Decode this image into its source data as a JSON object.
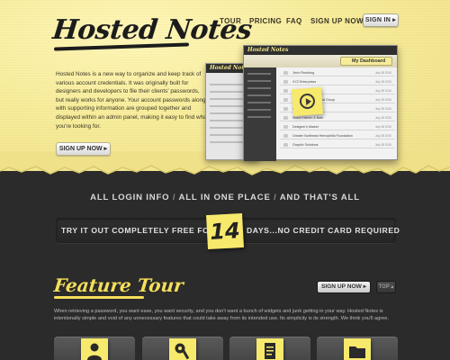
{
  "brand": {
    "logo_text": "Hosted Notes"
  },
  "nav": {
    "items": [
      {
        "label": "TOUR"
      },
      {
        "label": "PRICING"
      },
      {
        "label": "FAQ"
      },
      {
        "label": "SIGN UP NOW"
      }
    ],
    "sign_in_label": "SIGN IN ▸"
  },
  "hero": {
    "intro": "Hosted Notes is a new way to organize and keep track of various account credentials. It was originally built for designers and developers to file their clients' passwords, but really works for anyone. Your account passwords along with supporting information are grouped together and displayed within an admin panel, making it easy to find what you're looking for.",
    "signup_label": "SIGN UP NOW ▸"
  },
  "mockup": {
    "brand": "Hosted Notes",
    "dashboard_label": "My Dashboard",
    "rows": [
      {
        "name": "Jim's Plumbing",
        "date": "July 28 2010"
      },
      {
        "name": "XYZ Enterprises",
        "date": "July 28 2010"
      },
      {
        "name": "Internal Accounts",
        "date": "July 28 2010"
      },
      {
        "name": "Northeastern Financial Group",
        "date": "July 28 2010"
      },
      {
        "name": "Bill's Tennis Club",
        "date": "July 28 2010"
      },
      {
        "name": "Stone Kitchen & Bath",
        "date": "July 28 2010"
      },
      {
        "name": "Designer's Market",
        "date": "July 28 2010"
      },
      {
        "name": "Greater Northeast Hemophilia Foundation",
        "date": "July 28 2010"
      },
      {
        "name": "Graphic Solutions",
        "date": "July 28 2010"
      }
    ]
  },
  "promo": {
    "tagline_parts": [
      "ALL LOGIN INFO",
      "ALL IN ONE PLACE",
      "AND THAT'S ALL"
    ],
    "tagline_sep": "/",
    "trial_left": "TRY IT OUT COMPLETELY FREE FOR",
    "trial_days": "14",
    "trial_right": "DAYS...NO CREDIT CARD REQUIRED"
  },
  "features": {
    "title": "Feature Tour",
    "signup_label": "SIGN UP NOW ▸",
    "top_label": "TOP ▴",
    "description": "When retrieving a password, you want ease, you want security, and you don't want a bunch of widgets and junk getting in your way. Hosted Notes is intentionally simple and void of any unnecessary features that could take away from its intended use. Its simplicity is its strength. We think you'll agree.",
    "tiles": [
      {
        "icon": "user-icon"
      },
      {
        "icon": "key-icon"
      },
      {
        "icon": "document-icon"
      },
      {
        "icon": "folder-icon"
      }
    ]
  },
  "colors": {
    "paper": "#f7ec9a",
    "sticky_note": "#f7e96c",
    "dark_bg": "#2b2b2b",
    "accent_yellow": "#f5df5a"
  }
}
